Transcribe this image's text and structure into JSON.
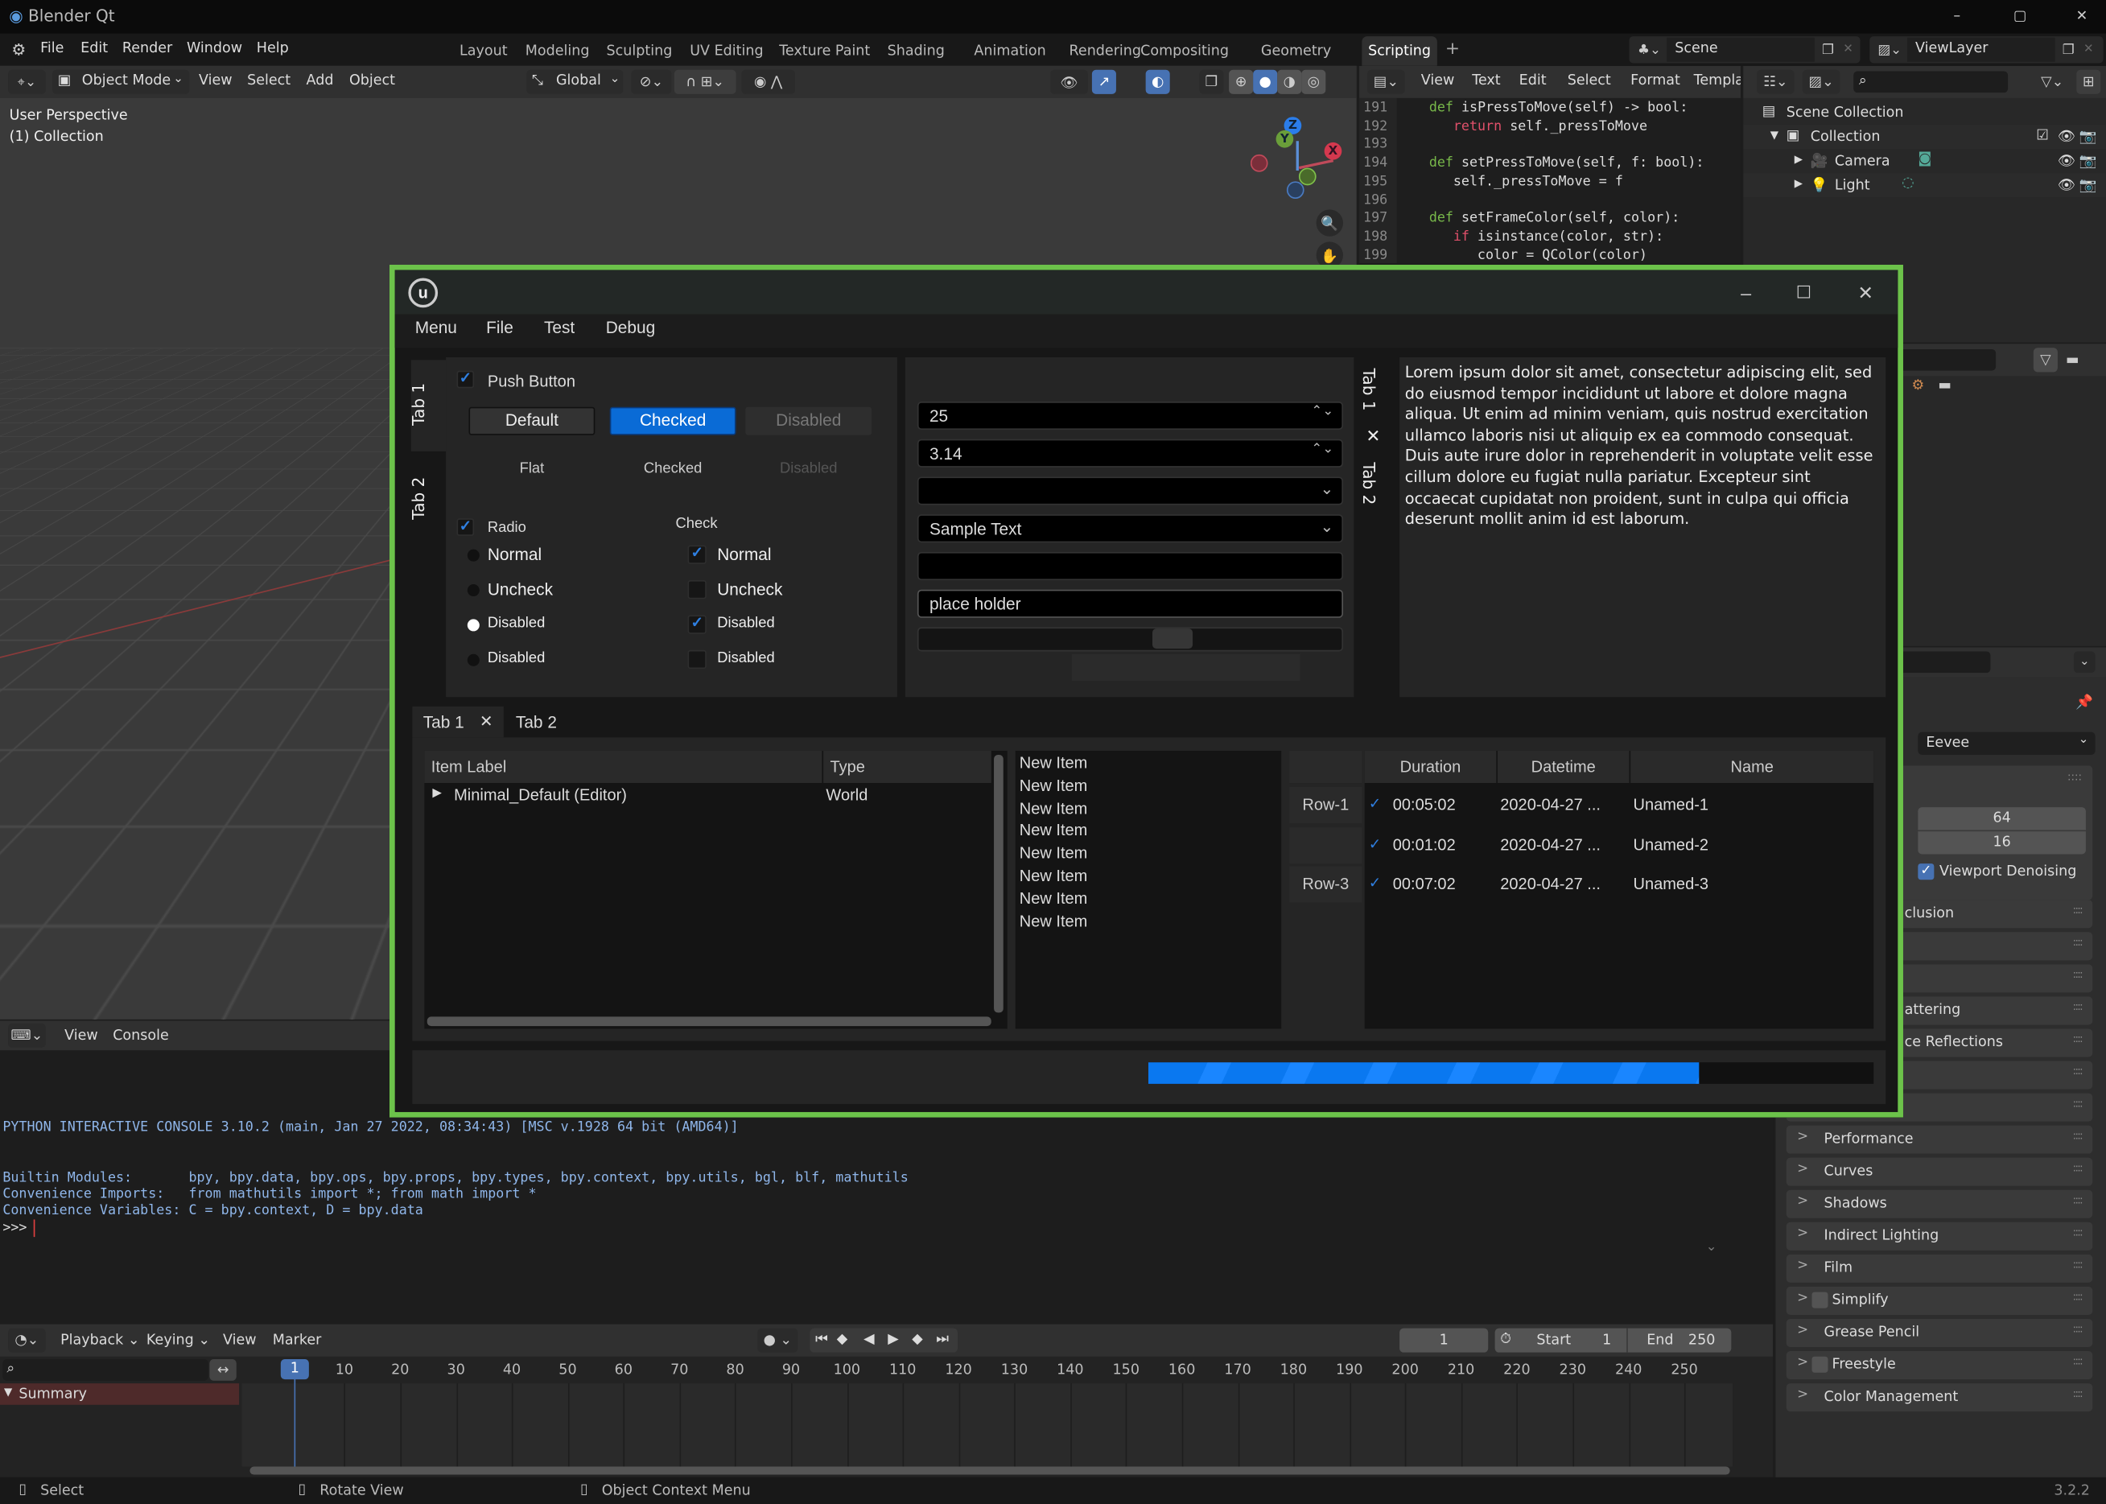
{
  "window": {
    "title": "Blender Qt",
    "controls": [
      "minimize",
      "maximize",
      "close"
    ]
  },
  "topbar": {
    "menus": [
      "File",
      "Edit",
      "Render",
      "Window",
      "Help"
    ],
    "workspaces": [
      "Layout",
      "Modeling",
      "Sculpting",
      "UV Editing",
      "Texture Paint",
      "Shading",
      "Animation",
      "Rendering",
      "Compositing",
      "Geometry Nodes",
      "Scripting"
    ],
    "active_workspace": "Scripting",
    "add_tab": "+",
    "scene": "Scene",
    "view_layer": "ViewLayer"
  },
  "viewport": {
    "mode": "Object Mode",
    "menus": [
      "View",
      "Select",
      "Add",
      "Object"
    ],
    "orientation": "Global",
    "overlay_title": "User Perspective",
    "overlay_collection": "(1) Collection",
    "gizmo_axes": [
      "Z",
      "Y",
      "X"
    ]
  },
  "text_editor": {
    "menus": [
      "View",
      "Text",
      "Edit",
      "Select",
      "Format",
      "Templat"
    ],
    "lines": [
      {
        "n": "191",
        "indent": 1,
        "kw": "def",
        "text": " isPressToMove(self) -> bool:"
      },
      {
        "n": "192",
        "indent": 2,
        "kw": "return",
        "text": " self._pressToMove"
      },
      {
        "n": "193",
        "indent": 0,
        "kw": "",
        "text": ""
      },
      {
        "n": "194",
        "indent": 1,
        "kw": "def",
        "text": " setPressToMove(self, f: bool):"
      },
      {
        "n": "195",
        "indent": 2,
        "kw": "",
        "text": "self._pressToMove = f"
      },
      {
        "n": "196",
        "indent": 0,
        "kw": "",
        "text": ""
      },
      {
        "n": "197",
        "indent": 1,
        "kw": "def",
        "text": " setFrameColor(self, color):"
      },
      {
        "n": "198",
        "indent": 2,
        "kw": "if",
        "text": " isinstance(color, str):"
      },
      {
        "n": "199",
        "indent": 3,
        "kw": "",
        "text": "color = QColor(color)"
      }
    ]
  },
  "outliner": {
    "items": [
      {
        "label": "Scene Collection",
        "depth": 0
      },
      {
        "label": "Collection",
        "depth": 1
      },
      {
        "label": "Camera",
        "depth": 2
      },
      {
        "label": "Light",
        "depth": 2
      }
    ]
  },
  "properties": {
    "render_engine": "Eevee",
    "sampling_render": "64",
    "sampling_viewport": "16",
    "viewport_denoising": "Viewport Denoising",
    "viewport_denoising_checked": true,
    "partial_panels": [
      "clusion",
      "",
      "",
      "attering",
      "ce Reflections",
      "",
      ""
    ],
    "panels": [
      {
        "label": "Performance",
        "checkbox": false
      },
      {
        "label": "Curves",
        "checkbox": false
      },
      {
        "label": "Shadows",
        "checkbox": false
      },
      {
        "label": "Indirect Lighting",
        "checkbox": false
      },
      {
        "label": "Film",
        "checkbox": false
      },
      {
        "label": "Simplify",
        "checkbox": true
      },
      {
        "label": "Grease Pencil",
        "checkbox": false
      },
      {
        "label": "Freestyle",
        "checkbox": true
      },
      {
        "label": "Color Management",
        "checkbox": false
      }
    ]
  },
  "console": {
    "menus": [
      "View",
      "Console"
    ],
    "lines": [
      "PYTHON INTERACTIVE CONSOLE 3.10.2 (main, Jan 27 2022, 08:34:43) [MSC v.1928 64 bit (AMD64)]",
      "",
      "Builtin Modules:       bpy, bpy.data, bpy.ops, bpy.props, bpy.types, bpy.context, bpy.utils, bgl, blf, mathutils",
      "Convenience Imports:   from mathutils import *; from math import *",
      "Convenience Variables: C = bpy.context, D = bpy.data"
    ],
    "prompt": ">>>"
  },
  "timeline": {
    "menus": [
      "Playback",
      "Keying",
      "View",
      "Marker"
    ],
    "current_frame": "1",
    "start_label": "Start",
    "start": "1",
    "end_label": "End",
    "end": "250",
    "ticks": [
      "1",
      "10",
      "20",
      "30",
      "40",
      "50",
      "60",
      "70",
      "80",
      "90",
      "100",
      "110",
      "120",
      "130",
      "140",
      "150",
      "160",
      "170",
      "180",
      "190",
      "200",
      "210",
      "220",
      "230",
      "240",
      "250"
    ],
    "summary": "Summary"
  },
  "statusbar": {
    "select": "Select",
    "rotate": "Rotate View",
    "context_menu": "Object Context Menu",
    "version": "3.2.2"
  },
  "qt": {
    "accent": "#0a6bd6",
    "frame_color": "#6cc24a",
    "menus": [
      "Menu",
      "File",
      "Test",
      "Debug"
    ],
    "side_tabs": [
      "Tab 1",
      "Tab 2"
    ],
    "push_button_label": "Push Button",
    "buttons": [
      "Default",
      "Checked",
      "Disabled"
    ],
    "flat_buttons": [
      "Flat",
      "Checked",
      "Disabled"
    ],
    "radio_label": "Radio",
    "check_label": "Check",
    "radios": [
      {
        "label": "Normal",
        "checked": false
      },
      {
        "label": "Uncheck",
        "checked": false
      },
      {
        "label": "Disabled",
        "checked": true
      },
      {
        "label": "Disabled",
        "checked": false
      }
    ],
    "checks": [
      {
        "label": "Normal",
        "checked": true
      },
      {
        "label": "Uncheck",
        "checked": false
      },
      {
        "label": "Disabled",
        "checked": true
      },
      {
        "label": "Disabled",
        "checked": false
      }
    ],
    "spin_int": "25",
    "spin_double": "3.14",
    "combo_empty": "",
    "combo_text": "Sample Text",
    "line_edit": "",
    "line_edit_2": "place holder",
    "slider_value_percent": 60,
    "right_tabs": [
      "Tab 1",
      "Tab 2"
    ],
    "text_body": "Lorem ipsum dolor sit amet, consectetur adipiscing elit, sed do eiusmod tempor incididunt ut labore et dolore magna aliqua. Ut enim ad minim veniam, quis nostrud exercitation ullamco laboris nisi ut aliquip ex ea commodo consequat. Duis aute irure dolor in reprehenderit in voluptate velit esse cillum dolore eu fugiat nulla pariatur. Excepteur sint occaecat cupidatat non proident, sunt in culpa qui officia deserunt mollit anim id est laborum.",
    "bottom_tabs": [
      "Tab 1",
      "Tab 2"
    ],
    "tree_headers": [
      "Item Label",
      "Type"
    ],
    "tree_rows": [
      {
        "label": "Minimal_Default (Editor)",
        "type": "World"
      }
    ],
    "list_items": [
      "New Item",
      "New Item",
      "New Item",
      "New Item",
      "New Item",
      "New Item",
      "New Item",
      "New Item"
    ],
    "table_headers": [
      "Duration",
      "Datetime",
      "Name"
    ],
    "table_rows": [
      {
        "header": "Row-1",
        "checked": true,
        "duration": "00:05:02",
        "datetime": "2020-04-27 ...",
        "name": "Unamed-1"
      },
      {
        "header": "",
        "checked": true,
        "duration": "00:01:02",
        "datetime": "2020-04-27 ...",
        "name": "Unamed-2"
      },
      {
        "header": "Row-3",
        "checked": true,
        "duration": "00:07:02",
        "datetime": "2020-04-27 ...",
        "name": "Unamed-3"
      }
    ],
    "progress_percent": 76
  }
}
